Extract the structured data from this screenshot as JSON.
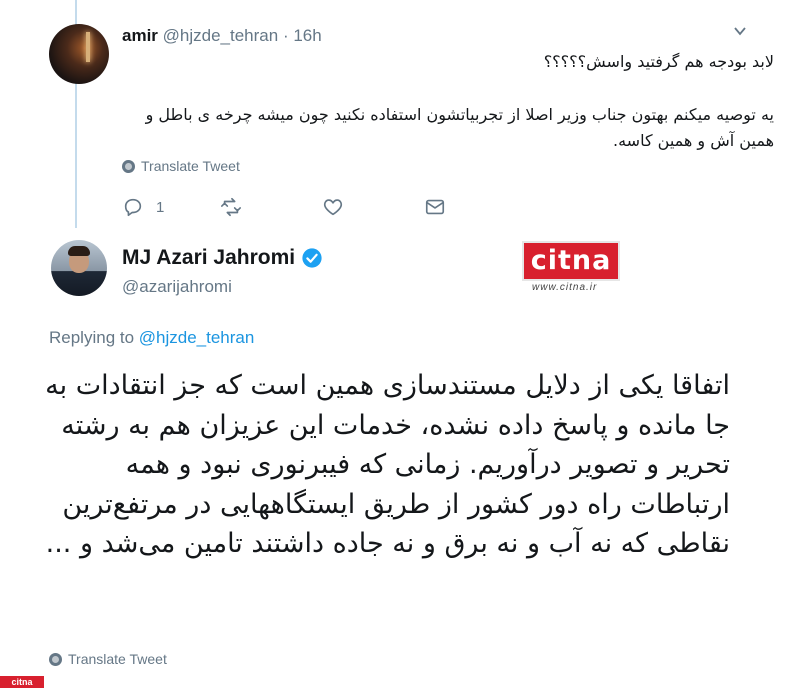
{
  "reply_tweet": {
    "author_name": "amir",
    "handle": "@hjzde_tehran",
    "separator": " · ",
    "time": "16h",
    "text_line1": "لابد بودجه هم گرفتید واسش؟؟؟؟؟",
    "text_line2": "یه توصیه میکنم بهتون جناب وزیر اصلا از تجربیاتشون استفاده نکنید چون میشه چرخه ی باطل و همین آش و همین کاسه.",
    "translate_label": "Translate Tweet",
    "actions": {
      "reply_icon": "reply-icon",
      "reply_count": "1",
      "retweet_icon": "retweet-icon",
      "like_icon": "heart-icon",
      "dm_icon": "envelope-icon"
    }
  },
  "main_tweet": {
    "author_name": "MJ Azari Jahromi",
    "handle": "@azarijahromi",
    "replying_prefix": "Replying to ",
    "replying_to": "@hjzde_tehran",
    "text": "اتفاقا یکی از دلایل مستندسازی همین است که جز انتقادات به جا مانده و پاسخ داده نشده، خدمات این عزیزان هم به رشته تحریر و تصویر درآوریم. زمانی که فیبرنوری نبود و همه ارتباطات راه دور کشور از طریق ایستگاههایی در مرتفع‌ترین نقاطی که نه آب و نه برق و نه جاده داشتند تامین می‌شد و ...",
    "translate_label": "Translate Tweet"
  },
  "watermark": {
    "logo_text": "citna",
    "url": "www.citna.ir",
    "corner_logo_text": "citna"
  },
  "colors": {
    "link": "#1b95e0",
    "muted": "#657786",
    "verified": "#1da1f2",
    "thread_line": "#c4dbec",
    "citna_red": "#d8202e"
  }
}
